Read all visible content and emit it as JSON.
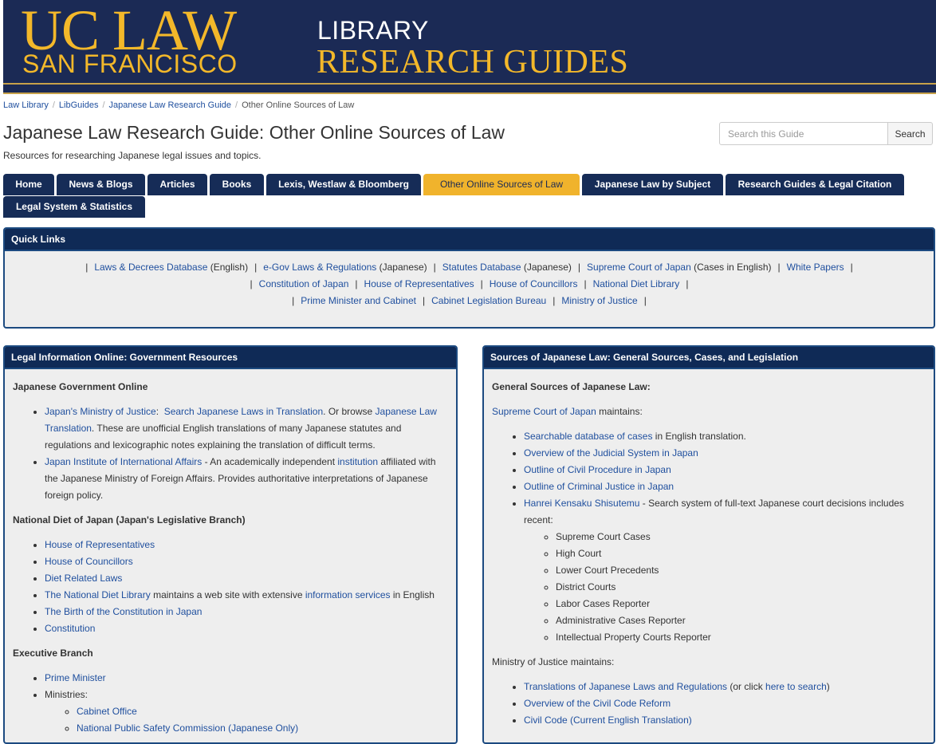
{
  "banner": {
    "logo_main": "UC LAW",
    "logo_sub": "SAN FRANCISCO",
    "library": "LIBRARY",
    "research_guides": "RESEARCH GUIDES"
  },
  "breadcrumb": {
    "items": [
      "Law Library",
      "LibGuides",
      "Japanese Law Research Guide"
    ],
    "current": "Other Online Sources of Law"
  },
  "page": {
    "title": "Japanese Law Research Guide: Other Online Sources of Law",
    "subtitle": "Resources for researching Japanese legal issues and topics."
  },
  "search": {
    "placeholder": "Search this Guide",
    "button": "Search"
  },
  "tabs": [
    "Home",
    "News & Blogs",
    "Articles",
    "Books",
    "Lexis, Westlaw & Bloomberg",
    "Other Online Sources of Law",
    "Japanese Law by Subject",
    "Research Guides & Legal Citation",
    "Legal System & Statistics"
  ],
  "colors": {
    "navy": "#162c57",
    "gold": "#f0b32c",
    "link": "#1f4f9e"
  },
  "quick_links": {
    "title": "Quick Links",
    "line1": [
      {
        "link": "Laws & Decrees Database",
        "note": " (English)"
      },
      {
        "link": "e-Gov Laws & Regulations",
        "note": " (Japanese)"
      },
      {
        "link": "Statutes Database",
        "note": " (Japanese)"
      },
      {
        "link": "Supreme Court of Japan",
        "note": " (Cases in English)"
      },
      {
        "link": "White Papers",
        "note": ""
      }
    ],
    "line2": [
      "Constitution of Japan",
      "House of Representatives",
      "House of Councillors",
      "National Diet Library"
    ],
    "line3": [
      "Prime Minister and Cabinet",
      "Cabinet Legislation Bureau",
      "Ministry of Justice"
    ],
    "separator": "|"
  },
  "left_box": {
    "title": "Legal Information Online: Government Resources",
    "sec1_heading": "Japanese Government Online",
    "moj_link": "Japan's Ministry of Justice",
    "moj_colon": ":",
    "search_laws_link": "Search Japanese Laws in Translation",
    "or_browse": ".  Or browse ",
    "jlt_link": "Japanese Law Translation",
    "moj_desc": ".  These are unofficial English translations of many Japanese statutes and regulations and lexicographic notes explaining the translation of difficult terms.",
    "jiia_link": "Japan Institute of International Affairs",
    "jiia_desc1": " - An academically independent ",
    "institution_link": "institution",
    "jiia_desc2": " affiliated with the Japanese Ministry of Foreign Affairs. Provides authoritative interpretations of Japanese foreign policy.",
    "sec2_heading": "National Diet of Japan (Japan's Legislative Branch)",
    "diet_items": [
      "House of Representatives",
      "House of Councillors",
      "Diet Related Laws"
    ],
    "ndl_link": "The National Diet Library",
    "ndl_desc": " maintains a web site with extensive ",
    "info_services_link": "information services",
    "in_english": " in English",
    "diet_items2": [
      "The Birth of the Constitution in Japan",
      "Constitution"
    ],
    "sec3_heading": "Executive Branch",
    "prime_minister": "Prime Minister",
    "ministries": "Ministries:",
    "ministry_items": [
      "Cabinet Office",
      "National Public Safety Commission (Japanese Only)"
    ]
  },
  "right_box": {
    "title": "Sources of Japanese Law: General Sources, Cases, and Legislation",
    "heading": "General Sources of Japanese Law:",
    "scj_link": "Supreme Court of Japan",
    "maintains": " maintains:",
    "searchable_link": "Searchable database of cases",
    "searchable_desc": " in English translation.",
    "scj_items": [
      "Overview of the Judicial System in Japan",
      "Outline of Civil Procedure in Japan",
      "Outline of Criminal Justice in Japan"
    ],
    "hanrei_link": "Hanrei Kensaku Shisutemu",
    "hanrei_desc": " - Search system of full-text Japanese court decisions includes recent:",
    "hanrei_items": [
      "Supreme Court Cases",
      "High Court",
      "Lower Court Precedents",
      "District Courts",
      "Labor Cases Reporter",
      "Administrative Cases Reporter",
      "Intellectual Property Courts Reporter"
    ],
    "moj_maintains": "Ministry of Justice maintains:",
    "translations_link": "Translations of Japanese Laws and Regulations",
    "or_click": " (or click ",
    "here_link": "here to search",
    "close_paren": ")",
    "moj_items": [
      "Overview of the Civil Code Reform",
      "Civil Code (Current English Translation)"
    ]
  }
}
